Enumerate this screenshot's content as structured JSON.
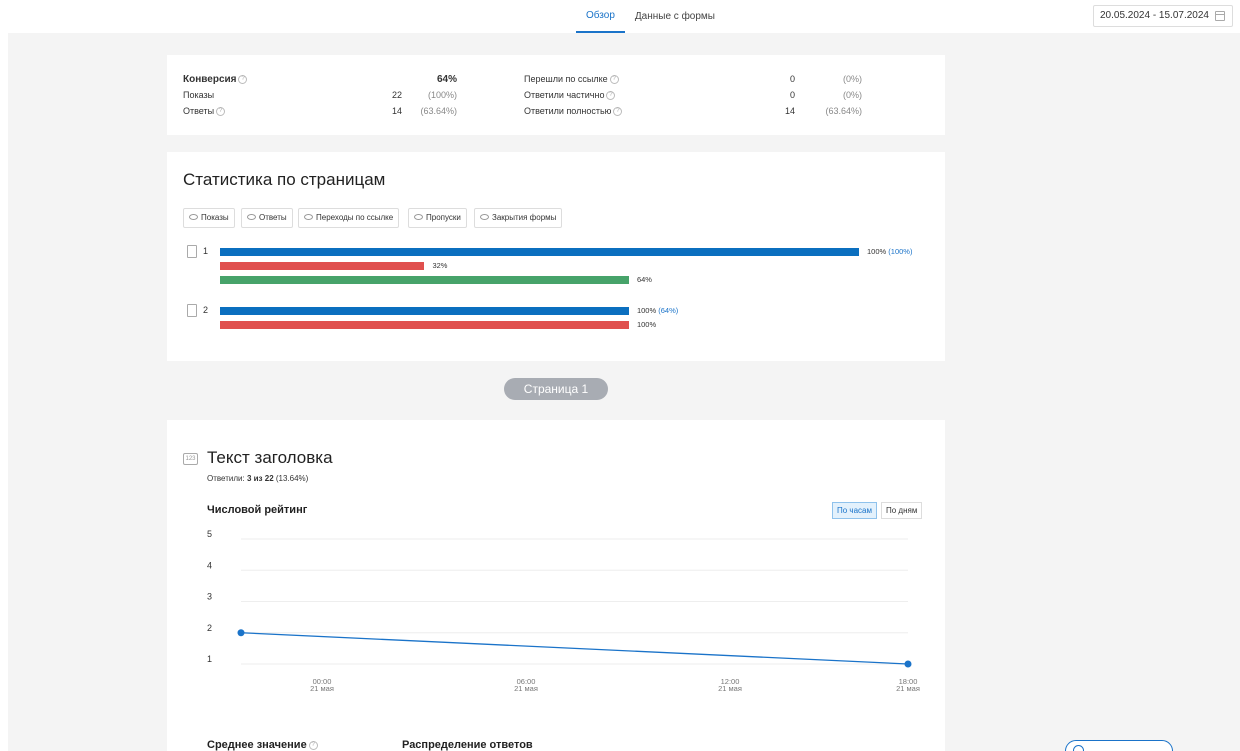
{
  "header": {
    "tabs": [
      {
        "label": "Обзор",
        "active": true
      },
      {
        "label": "Данные с формы",
        "active": false
      }
    ],
    "date_range": "20.05.2024 - 15.07.2024",
    "accent_color": "#1a73c9"
  },
  "conversion": {
    "conversion_label": "Конверсия",
    "conversion_value": "64%",
    "views_label": "Показы",
    "views_value": "22",
    "views_pct": "(100%)",
    "answers_label": "Ответы",
    "answers_value": "14",
    "answers_pct": "(63.64%)",
    "link_label": "Перешли по ссылке",
    "link_value": "0",
    "link_pct": "(0%)",
    "partial_label": "Ответили частично",
    "partial_value": "0",
    "partial_pct": "(0%)",
    "full_label": "Ответили полностью",
    "full_value": "14",
    "full_pct": "(63.64%)"
  },
  "page_stats": {
    "title": "Статистика по страницам",
    "filters": [
      "Показы",
      "Ответы",
      "Переходы по ссылке",
      "Пропуски",
      "Закрытия формы"
    ],
    "colors": {
      "views": "#0b6fbf",
      "skips": "#e0504e",
      "answers": "#47a36a"
    },
    "pages": [
      {
        "number": "1",
        "bars": [
          {
            "kind": "views",
            "value": 100,
            "label": "100%",
            "extra": "(100%)"
          },
          {
            "kind": "skips",
            "value": 32,
            "label": "32%",
            "extra": ""
          },
          {
            "kind": "answers",
            "value": 64,
            "label": "64%",
            "extra": ""
          }
        ]
      },
      {
        "number": "2",
        "bars": [
          {
            "kind": "views",
            "value": 64,
            "label": "100%",
            "extra": "(64%)"
          },
          {
            "kind": "skips",
            "value": 64,
            "label": "100%",
            "extra": ""
          }
        ]
      }
    ]
  },
  "page_pill": "Страница 1",
  "question": {
    "icon_text": "123",
    "title": "Текст заголовка",
    "answered_prefix": "Ответили: ",
    "answered_count": "3 из 22",
    "answered_pct": " (13.64%)",
    "chart_title": "Числовой рейтинг",
    "toggle_hours": "По часам",
    "toggle_days": "По дням",
    "avg_label": "Среднее значение",
    "distribution_label": "Распределение ответов"
  },
  "chart_data": {
    "type": "line",
    "title": "Числовой рейтинг",
    "x": [
      "20 мая 21:00",
      "21 мая 18:00"
    ],
    "series": [
      {
        "values": [
          2,
          1
        ]
      }
    ],
    "y_ticks": [
      "1",
      "2",
      "3",
      "4",
      "5"
    ],
    "x_ticks": [
      {
        "time": "00:00",
        "date": "21 мая"
      },
      {
        "time": "06:00",
        "date": "21 мая"
      },
      {
        "time": "12:00",
        "date": "21 мая"
      },
      {
        "time": "18:00",
        "date": "21 мая"
      }
    ],
    "ylim": [
      1,
      5
    ],
    "grid": true,
    "color": "#1a73c9"
  }
}
